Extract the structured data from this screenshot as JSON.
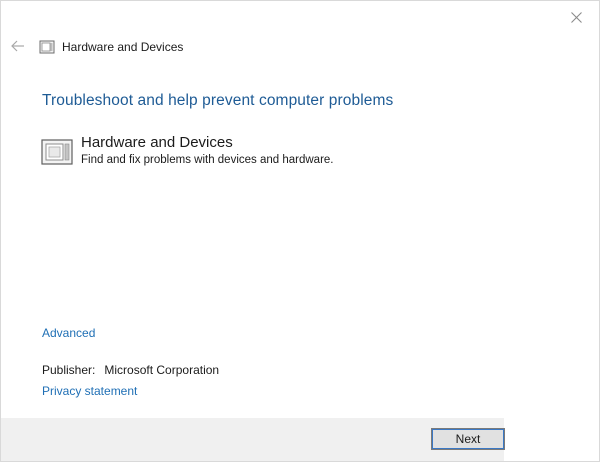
{
  "window": {
    "title": "Hardware and Devices"
  },
  "heading": "Troubleshoot and help prevent computer problems",
  "option": {
    "title": "Hardware and Devices",
    "description": "Find and fix problems with devices and hardware."
  },
  "links": {
    "advanced": "Advanced",
    "privacy": "Privacy statement"
  },
  "publisher": {
    "label": "Publisher:",
    "value": "Microsoft Corporation"
  },
  "buttons": {
    "next": "Next"
  },
  "icons": {
    "close": "close-icon",
    "back": "back-arrow-icon",
    "hardware": "hardware-devices-icon"
  },
  "colors": {
    "heading": "#1e5b95",
    "link": "#1f6fb5",
    "footer": "#f0f0f0"
  }
}
